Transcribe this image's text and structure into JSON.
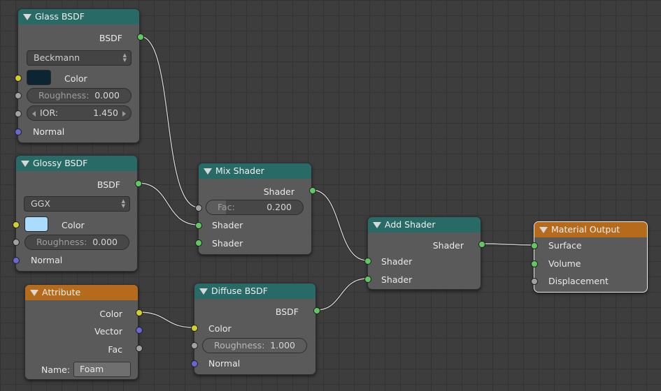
{
  "colors": {
    "shader_socket": "#61c861",
    "color_socket": "#cfcf2e",
    "value_socket": "#a1a1a1",
    "vector_socket": "#6868d0",
    "shader_header": "#276a66",
    "input_header": "#b56a1c",
    "glass_color_swatch": "#0b2533",
    "glossy_color_swatch": "#a9dcff"
  },
  "glass": {
    "title": "Glass BSDF",
    "output": "BSDF",
    "distribution": "Beckmann",
    "color_label": "Color",
    "roughness_label": "Roughness:",
    "roughness_value": "0.000",
    "ior_label": "IOR:",
    "ior_value": "1.450",
    "normal_label": "Normal"
  },
  "glossy": {
    "title": "Glossy BSDF",
    "output": "BSDF",
    "distribution": "GGX",
    "color_label": "Color",
    "roughness_label": "Roughness:",
    "roughness_value": "0.000",
    "normal_label": "Normal"
  },
  "attribute": {
    "title": "Attribute",
    "out_color": "Color",
    "out_vector": "Vector",
    "out_fac": "Fac",
    "name_label": "Name:",
    "name_value": "Foam"
  },
  "mix": {
    "title": "Mix Shader",
    "output": "Shader",
    "fac_label": "Fac:",
    "fac_value": "0.200",
    "fac_fraction": 0.2,
    "in1": "Shader",
    "in2": "Shader"
  },
  "diffuse": {
    "title": "Diffuse BSDF",
    "output": "BSDF",
    "color_label": "Color",
    "roughness_label": "Roughness:",
    "roughness_value": "1.000",
    "normal_label": "Normal"
  },
  "add": {
    "title": "Add Shader",
    "output": "Shader",
    "in1": "Shader",
    "in2": "Shader"
  },
  "output": {
    "title": "Material Output",
    "surface": "Surface",
    "volume": "Volume",
    "displacement": "Displacement"
  }
}
